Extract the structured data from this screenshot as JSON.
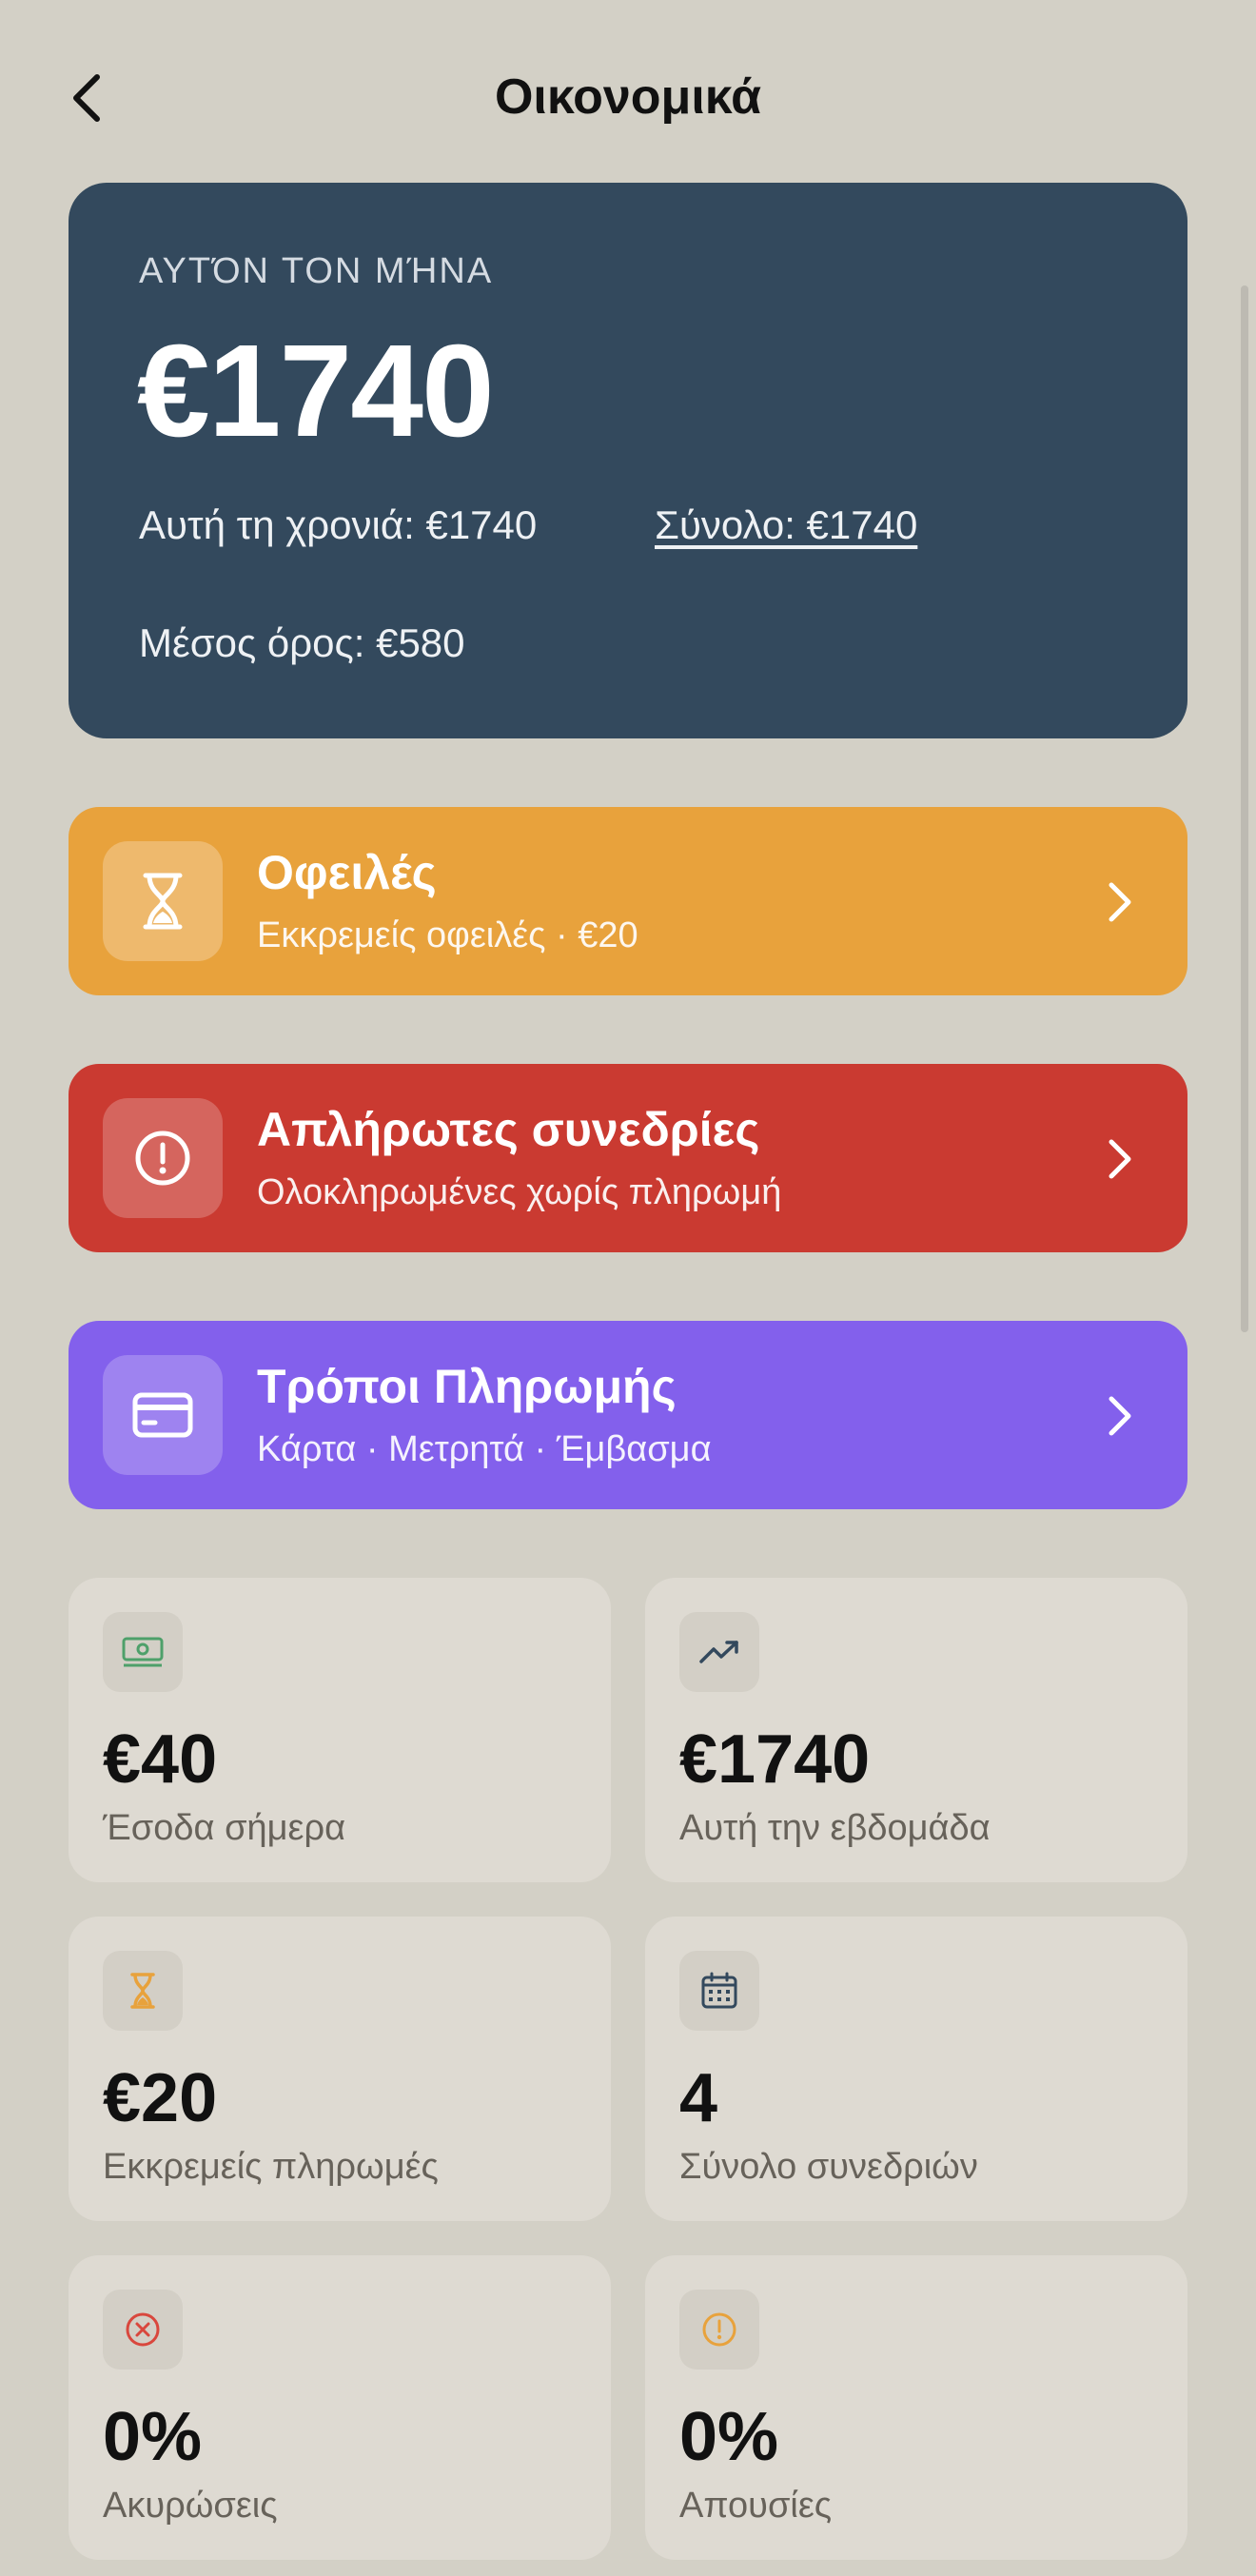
{
  "header": {
    "title": "Οικονομικά",
    "back_icon": "chevron-left-icon"
  },
  "summary": {
    "caption": "ΑΥΤΌΝ ΤΟΝ ΜΉΝΑ",
    "amount": "€1740",
    "year_text": "Αυτή τη χρονιά: €1740",
    "total_text": "Σύνολο: €1740",
    "average_text": "Μέσος όρος: €580",
    "background": "#33495d"
  },
  "actions": [
    {
      "title": "Οφειλές",
      "subtitle": "Εκκρεμείς οφειλές · €20",
      "icon": "hourglass-icon",
      "color": "#e8a23c"
    },
    {
      "title": "Απλήρωτες συνεδρίες",
      "subtitle": "Ολοκληρωμένες χωρίς πληρωμή",
      "icon": "alert-circle-icon",
      "color": "#ca3a31"
    },
    {
      "title": "Τρόποι Πληρωμής",
      "subtitle": "Κάρτα · Μετρητά · Έμβασμα",
      "icon": "credit-card-icon",
      "color": "#8360ec"
    }
  ],
  "stats": [
    {
      "value": "€40",
      "label": "Έσοδα σήμερα",
      "icon": "cash-icon",
      "icon_color": "#4ea06a"
    },
    {
      "value": "€1740",
      "label": "Αυτή την εβδομάδα",
      "icon": "trending-up-icon",
      "icon_color": "#33495d"
    },
    {
      "value": "€20",
      "label": "Εκκρεμείς πληρωμές",
      "icon": "hourglass-icon",
      "icon_color": "#e8a23c"
    },
    {
      "value": "4",
      "label": "Σύνολο συνεδριών",
      "icon": "calendar-icon",
      "icon_color": "#33495d"
    },
    {
      "value": "0%",
      "label": "Ακυρώσεις",
      "icon": "x-circle-icon",
      "icon_color": "#d9473d"
    },
    {
      "value": "0%",
      "label": "Απουσίες",
      "icon": "alert-circle-icon",
      "icon_color": "#e8a23c"
    }
  ]
}
